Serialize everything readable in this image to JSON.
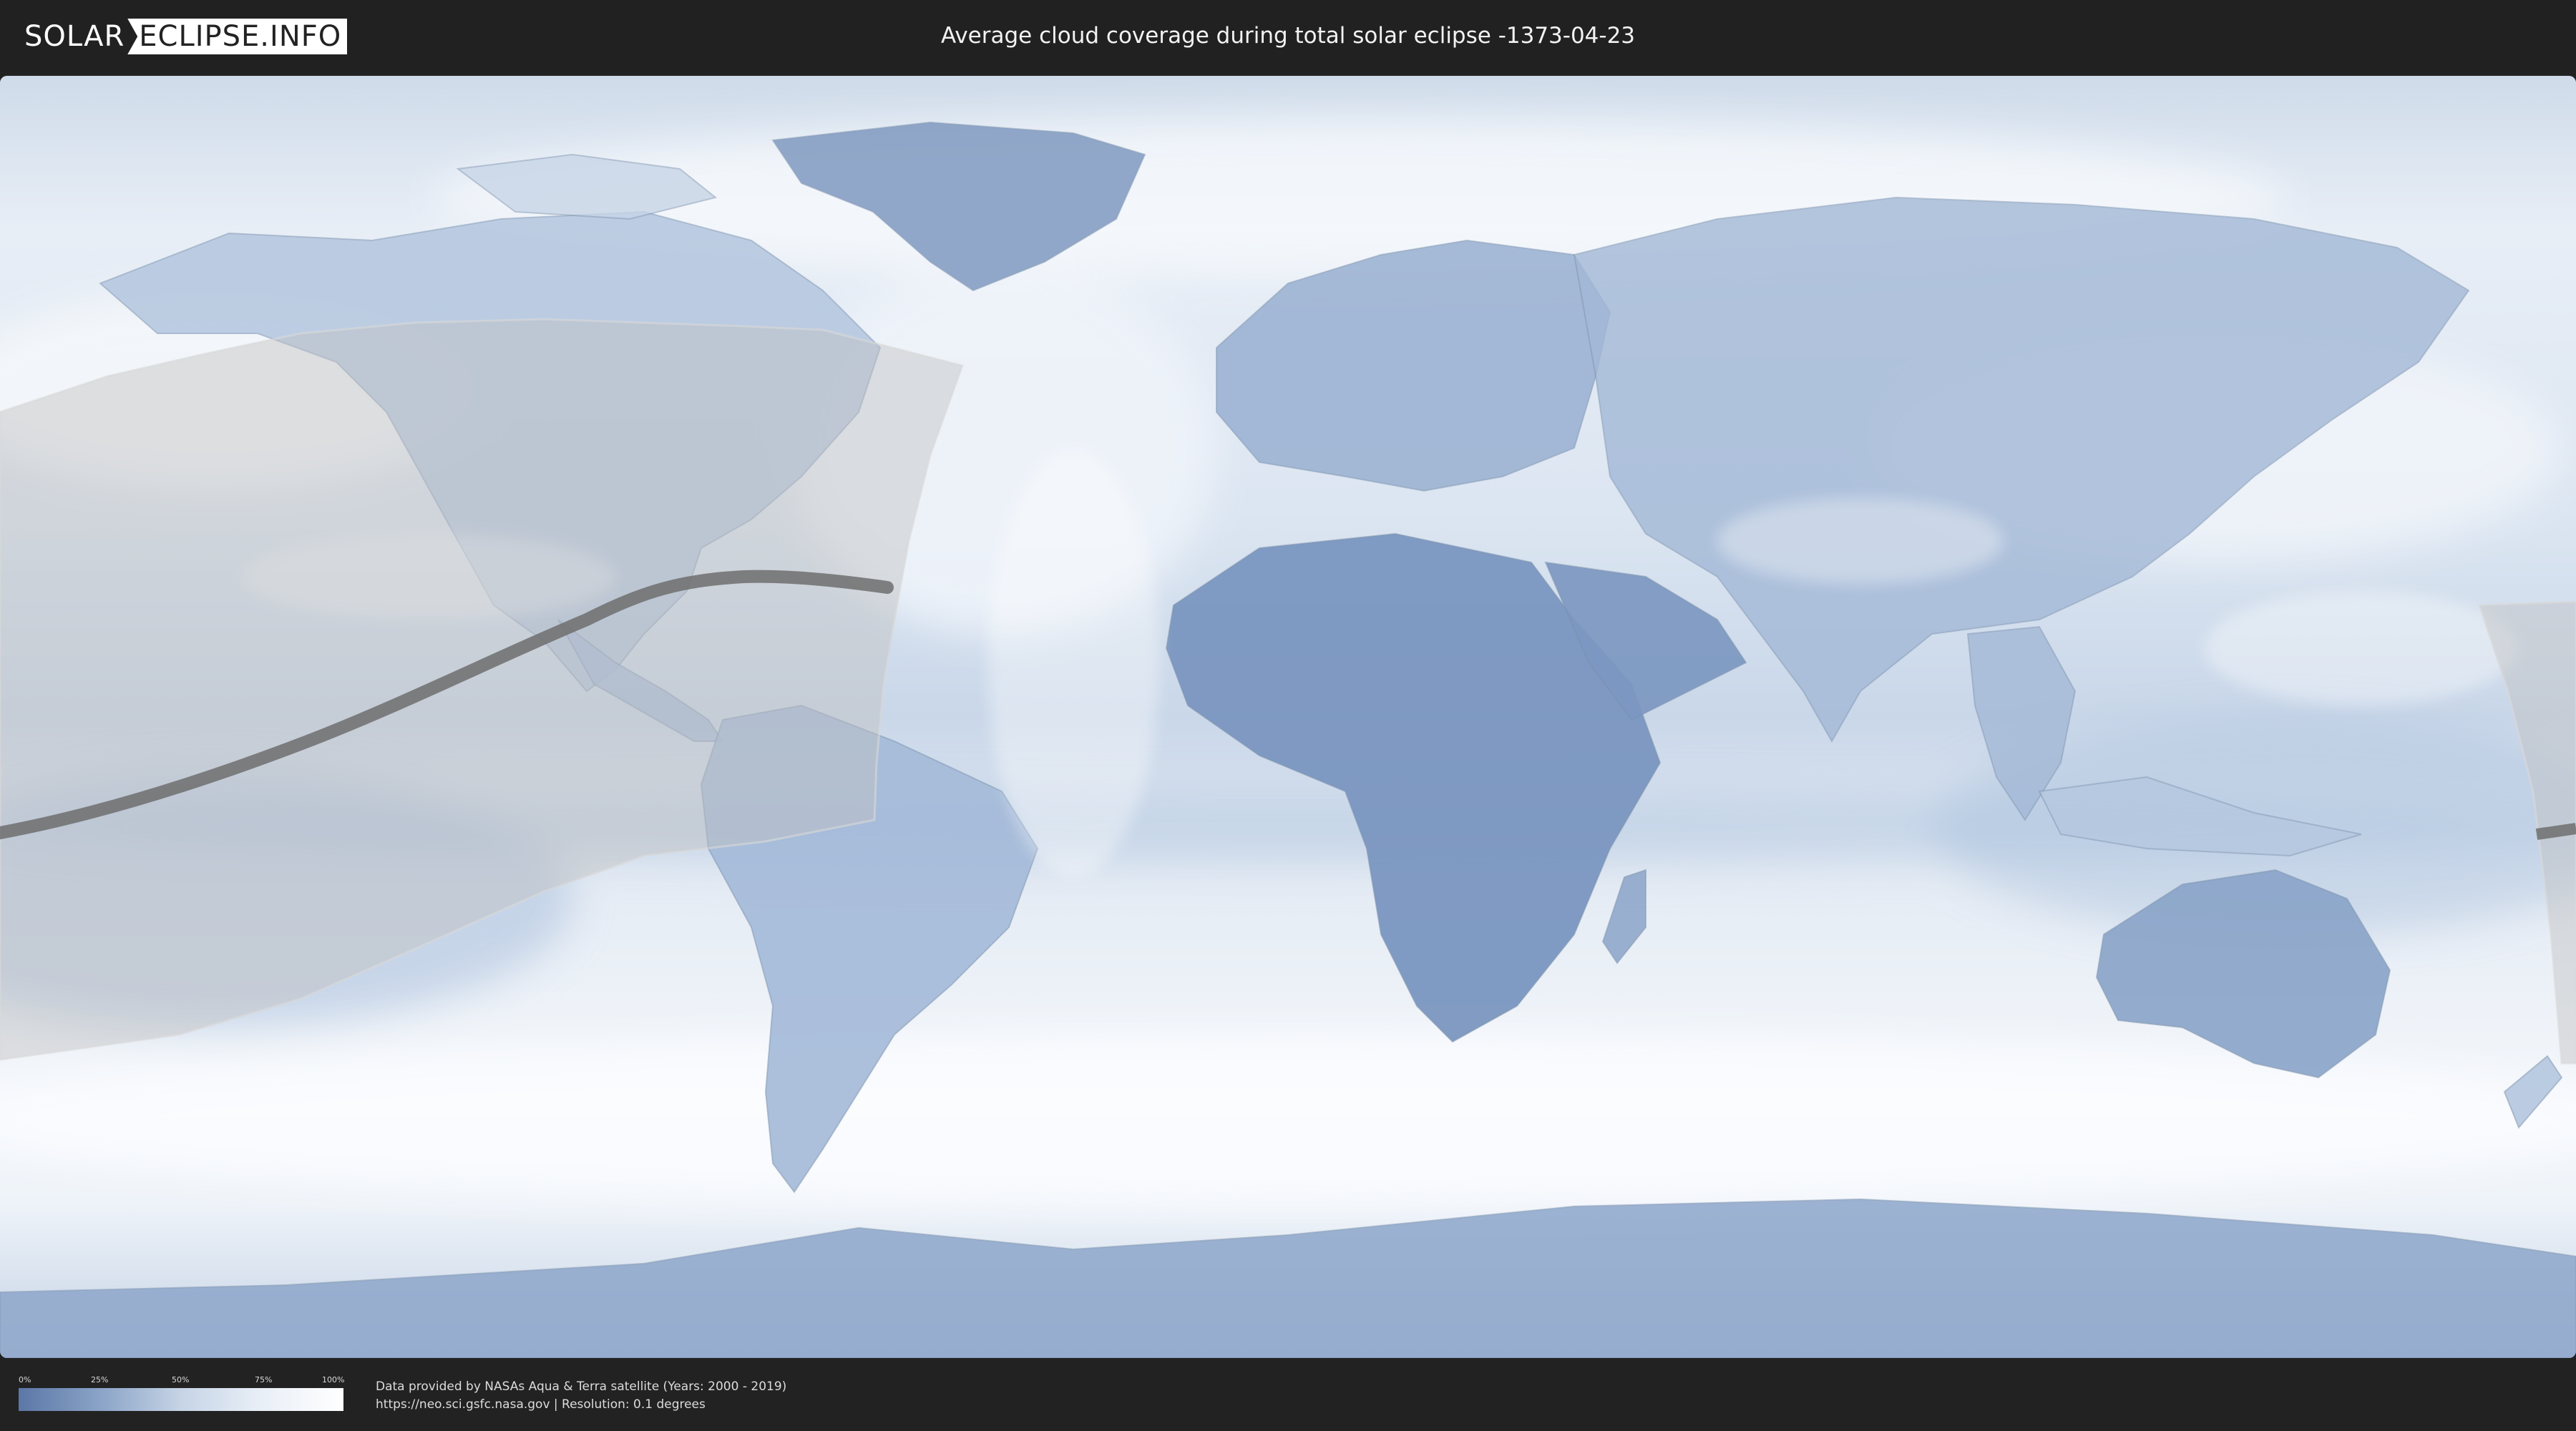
{
  "header": {
    "logo_left": "SOLAR",
    "logo_right": "ECLIPSE.INFO",
    "title": "Average cloud coverage during total solar eclipse -1373-04-23"
  },
  "legend": {
    "ticks": [
      "0%",
      "25%",
      "50%",
      "75%",
      "100%"
    ],
    "gradient_colors": [
      "#5b77a6",
      "#8aa3c7",
      "#c6d4e6",
      "#e9eff7",
      "#ffffff"
    ]
  },
  "credits": {
    "line1": "Data provided by NASAs Aqua & Terra satellite (Years: 2000 - 2019)",
    "line2": "https://neo.sci.gsfc.nasa.gov | Resolution: 0.1 degrees"
  },
  "map": {
    "projection": "equirectangular",
    "colors": {
      "clear": "#5b77a6",
      "cloudy": "#ffffff",
      "eclipse_zone": "#bdbdbd",
      "totality_path": "#6a6a6a",
      "borders": "#7f93ad"
    }
  }
}
